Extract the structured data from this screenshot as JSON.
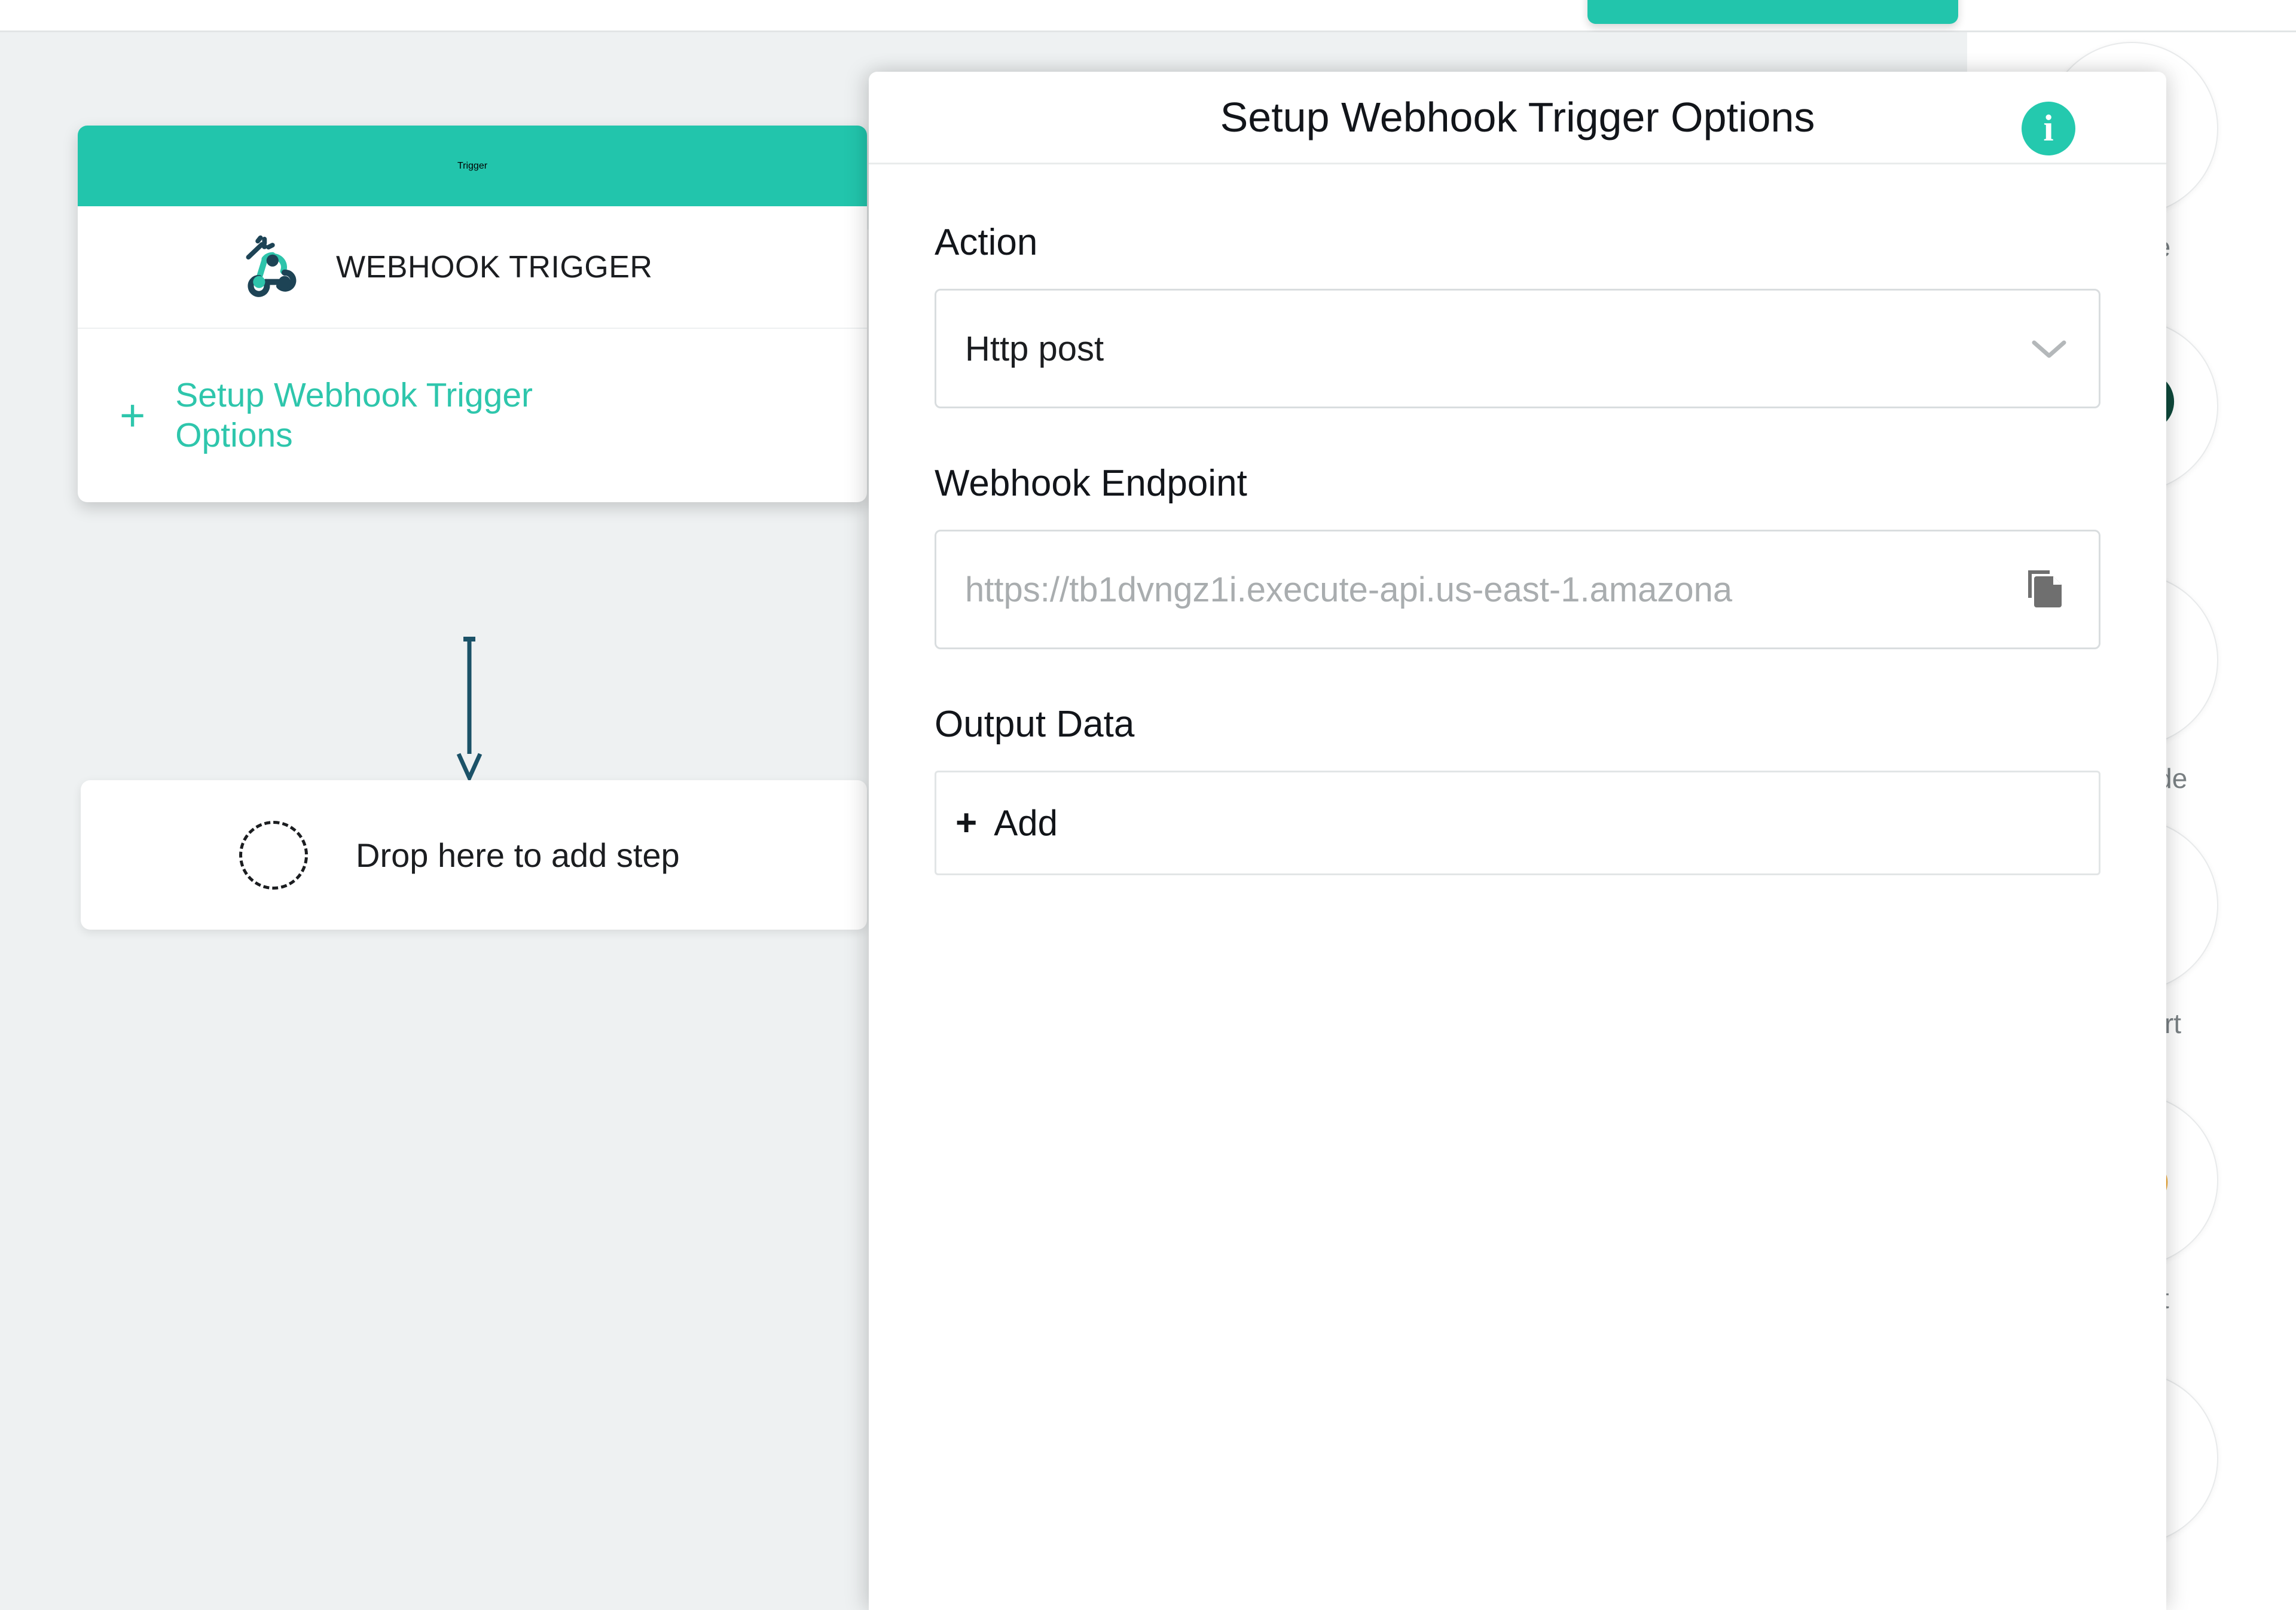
{
  "top": {
    "action_button_label": ""
  },
  "workflow": {
    "trigger_card": {
      "header_label": "Trigger",
      "node_label": "WEBHOOK TRIGGER",
      "node_icon": "webhook-magic-icon",
      "setup_link_label": "Setup Webhook Trigger Options",
      "setup_plus_glyph": "+"
    },
    "connector_icon": "down-arrow-connector",
    "drop_zone": {
      "label": "Drop here to add step",
      "placeholder_icon": "dashed-circle-icon"
    }
  },
  "modal": {
    "title": "Setup Webhook Trigger Options",
    "info_icon": "info-icon",
    "info_glyph": "i",
    "fields": {
      "action": {
        "label": "Action",
        "value": "Http post",
        "chevron_icon": "chevron-down-icon"
      },
      "webhook_endpoint": {
        "label": "Webhook Endpoint",
        "placeholder": "https://tb1dvngz1i.execute-api.us-east-1.amazona",
        "copy_icon": "copy-icon"
      },
      "output_data": {
        "label": "Output Data",
        "add_label": "Add",
        "add_plus": "+"
      }
    }
  },
  "side_rail": {
    "items": [
      {
        "label": "...rage",
        "icon": "s3-bucket-icon"
      },
      {
        "label": "",
        "icon": "search-magnifier-icon"
      },
      {
        "label": "...nscode",
        "icon": "transcode-icon"
      },
      {
        "label": "...onvert",
        "icon": "convert-play-icon"
      },
      {
        "label": "...cript",
        "icon": "transcript-parrot-icon"
      },
      {
        "label": "",
        "icon": "blue-bird-icon"
      }
    ]
  },
  "colors": {
    "accent_teal": "#22c5ac",
    "info_teal": "#24c9ae",
    "canvas_bg": "#eef1f2",
    "arrow_navy": "#1b5268",
    "placeholder_gray": "#a9adaf",
    "icon_gray": "#6f6f6f"
  }
}
